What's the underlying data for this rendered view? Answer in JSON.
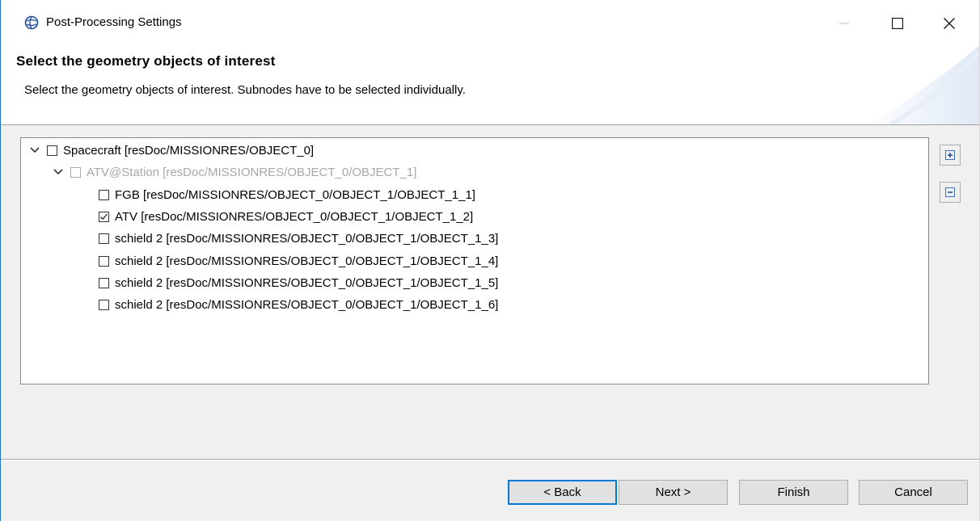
{
  "window": {
    "title": "Post-Processing Settings",
    "app_icon": "eclipse-globe-icon",
    "controls": {
      "minimize_icon": "minimize-icon",
      "maximize_icon": "maximize-icon",
      "close_icon": "close-icon"
    }
  },
  "header": {
    "title": "Select the geometry objects of interest",
    "description": "Select the geometry objects of interest. Subnodes have to be selected individually."
  },
  "tree": {
    "items": [
      {
        "label": "Spacecraft [resDoc/MISSIONRES/OBJECT_0]",
        "level": 0,
        "expanded": true,
        "checked": false,
        "enabled": true
      },
      {
        "label": "ATV@Station [resDoc/MISSIONRES/OBJECT_0/OBJECT_1]",
        "level": 1,
        "expanded": true,
        "checked": false,
        "enabled": false
      },
      {
        "label": "FGB [resDoc/MISSIONRES/OBJECT_0/OBJECT_1/OBJECT_1_1]",
        "level": 2,
        "checked": false,
        "enabled": true
      },
      {
        "label": "ATV [resDoc/MISSIONRES/OBJECT_0/OBJECT_1/OBJECT_1_2]",
        "level": 2,
        "checked": true,
        "enabled": true
      },
      {
        "label": "schield 2 [resDoc/MISSIONRES/OBJECT_0/OBJECT_1/OBJECT_1_3]",
        "level": 2,
        "checked": false,
        "enabled": true
      },
      {
        "label": "schield 2 [resDoc/MISSIONRES/OBJECT_0/OBJECT_1/OBJECT_1_4]",
        "level": 2,
        "checked": false,
        "enabled": true
      },
      {
        "label": "schield 2 [resDoc/MISSIONRES/OBJECT_0/OBJECT_1/OBJECT_1_5]",
        "level": 2,
        "checked": false,
        "enabled": true
      },
      {
        "label": "schield 2 [resDoc/MISSIONRES/OBJECT_0/OBJECT_1/OBJECT_1_6]",
        "level": 2,
        "checked": false,
        "enabled": true
      }
    ],
    "side_buttons": {
      "expand_all_icon": "expand-all-icon",
      "collapse_all_icon": "collapse-all-icon"
    }
  },
  "footer": {
    "back_label": "< Back",
    "next_label": "Next >",
    "finish_label": "Finish",
    "cancel_label": "Cancel"
  },
  "colors": {
    "default_button_border": "#0078d7",
    "disabled_text": "#a8a8a8",
    "window_accent": "#1a73c9"
  }
}
